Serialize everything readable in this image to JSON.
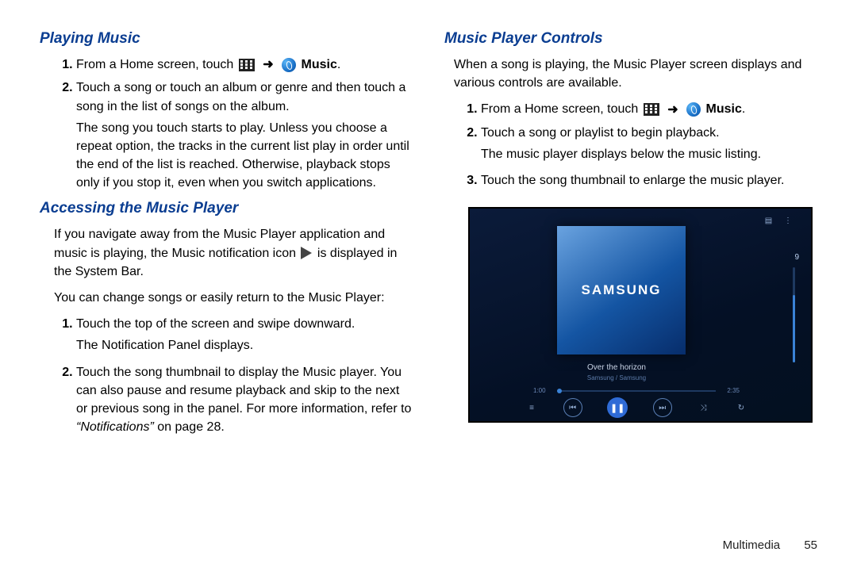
{
  "left": {
    "h1": "Playing Music",
    "playing": {
      "s1a": "From a Home screen, touch ",
      "s1b": "Music",
      "s2": "Touch a song or touch an album or genre and then touch a song in the list of songs on the album.",
      "s2_para": "The song you touch starts to play. Unless you choose a repeat option, the tracks in the current list play in order until the end of the list is reached. Otherwise, playback stops only if you stop it, even when you switch applications."
    },
    "h2": "Accessing the Music Player",
    "access": {
      "p1a": "If you navigate away from the Music Player application and music is playing, the Music notification icon ",
      "p1b": " is displayed in the System Bar.",
      "p2": "You can change songs or easily return to the Music Player:",
      "s1": "Touch the top of the screen and swipe downward.",
      "s1_para": "The Notification Panel displays.",
      "s2a": "Touch the song thumbnail to display the Music player. You can also pause and resume playback and skip to the next or previous song in the panel. For more information, refer to ",
      "s2_ref": "“Notifications”",
      "s2b": " on page 28."
    }
  },
  "right": {
    "h1": "Music Player Controls",
    "intro": "When a song is playing, the Music Player screen displays and various controls are available.",
    "s1a": "From a Home screen, touch ",
    "s1b": "Music",
    "s2": "Touch a song or playlist to begin playback.",
    "s2_para": "The music player displays below the music listing.",
    "s3": "Touch the song thumbnail to enlarge the music player."
  },
  "player": {
    "brand": "SAMSUNG",
    "track": "Over the horizon",
    "artist": "Samsung / Samsung",
    "time_l": "1:00",
    "time_r": "2:35",
    "volume": "9"
  },
  "footer": {
    "section": "Multimedia",
    "page": "55"
  },
  "glyph": {
    "arrow": "➜",
    "dot": "."
  }
}
